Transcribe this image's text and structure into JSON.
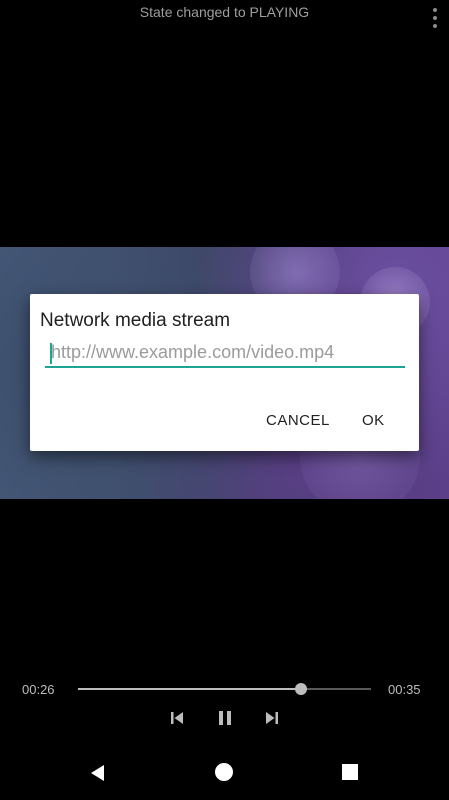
{
  "status": {
    "text": "State changed to PLAYING"
  },
  "dialog": {
    "title": "Network media stream",
    "input_value": "",
    "input_placeholder": "http://www.example.com/video.mp4",
    "cancel_label": "CANCEL",
    "ok_label": "OK"
  },
  "player": {
    "current_time": "00:26",
    "total_time": "00:35",
    "progress_fraction": 0.76,
    "controls": [
      "skip-previous-icon",
      "pause-icon",
      "skip-next-icon"
    ]
  },
  "colors": {
    "accent": "#1aa595",
    "dialog_bg": "#ffffff",
    "background": "#000000"
  }
}
